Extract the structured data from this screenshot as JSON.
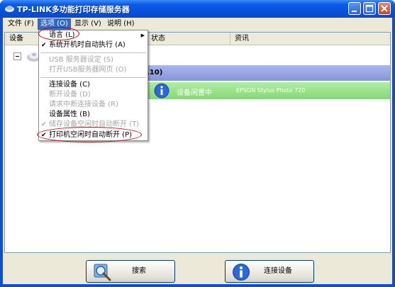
{
  "window": {
    "title": "TP-LINK多功能打印存储服务器"
  },
  "menubar": {
    "items": [
      {
        "label": "文件 (F)",
        "active": false
      },
      {
        "label": "选项 (O)",
        "active": true
      },
      {
        "label": "显示 (V)",
        "active": false
      },
      {
        "label": "说明 (H)",
        "active": false
      }
    ]
  },
  "listview": {
    "columns": [
      "设备",
      "状态",
      "资讯"
    ],
    "server_row": {
      "label_fragment": ".10)"
    },
    "printer_row": {
      "status": "设备闲置中",
      "info": "EPSON Stylus Photo 720"
    }
  },
  "options_menu": {
    "items": [
      {
        "label": "语言 (L)",
        "checked": false,
        "disabled": false,
        "submenu": true
      },
      {
        "label": "系统开机时自动执行 (A)",
        "checked": true,
        "disabled": false,
        "submenu": false
      },
      {
        "label": "USB 服务器设定 (S)",
        "checked": false,
        "disabled": true,
        "submenu": false
      },
      {
        "label": "打开USB服务器网页 (O)",
        "checked": false,
        "disabled": true,
        "submenu": false
      },
      {
        "label": "连接设备 (C)",
        "checked": false,
        "disabled": false,
        "submenu": false
      },
      {
        "label": "断开设备 (D)",
        "checked": false,
        "disabled": true,
        "submenu": false
      },
      {
        "label": "请求中断连接设备 (R)",
        "checked": false,
        "disabled": true,
        "submenu": false
      },
      {
        "label": "设备属性 (B)",
        "checked": false,
        "disabled": false,
        "submenu": false
      },
      {
        "label": "储存设备空闲时自动断开 (T)",
        "checked": true,
        "disabled": true,
        "submenu": false
      },
      {
        "label": "打印机空闲时自动断开 (P)",
        "checked": true,
        "disabled": false,
        "submenu": false
      }
    ]
  },
  "buttons": {
    "search_label": "搜索",
    "connect_label": "连接设备"
  },
  "colors": {
    "titlebar": "#0653de",
    "server_row": "#9aa6e3",
    "printer_row": "#9be28b",
    "highlight_oval": "#c0000c",
    "menu_active": "#316ac5"
  }
}
